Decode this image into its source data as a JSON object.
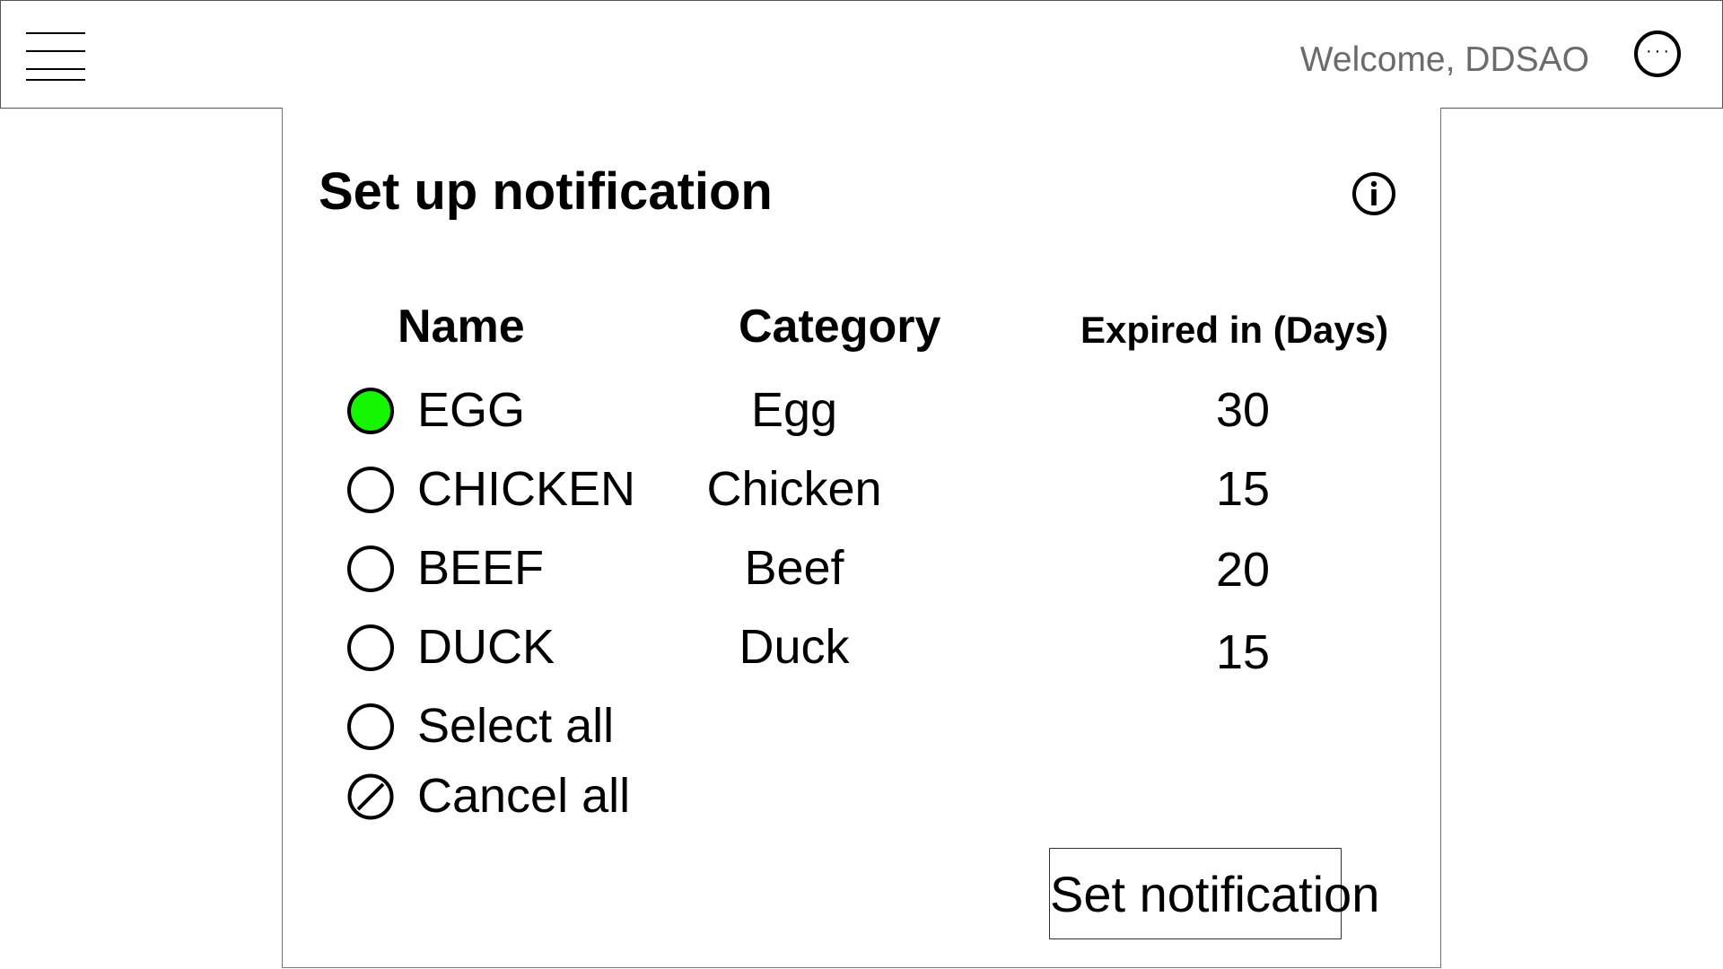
{
  "header": {
    "welcome_text": "Welcome, DDSAO",
    "menu_icon": "hamburger-menu-icon",
    "more_icon": "more-options-icon",
    "more_glyph": "···"
  },
  "panel": {
    "title": "Set up notification",
    "info_icon": "info-icon"
  },
  "table": {
    "columns": [
      "Name",
      "Category",
      "Expired in (Days)"
    ],
    "rows": [
      {
        "name": "EGG",
        "category": "Egg",
        "expires": "30",
        "selected": true
      },
      {
        "name": "CHICKEN",
        "category": "Chicken",
        "expires": "15",
        "selected": false
      },
      {
        "name": "BEEF",
        "category": "Beef",
        "expires": "20",
        "selected": false
      },
      {
        "name": "DUCK",
        "category": "Duck",
        "expires": "15",
        "selected": false
      }
    ],
    "select_all_label": "Select all",
    "cancel_all_label": "Cancel all"
  },
  "actions": {
    "set_notification_label": "Set notification"
  },
  "colors": {
    "selected_fill": "#16f500",
    "welcome_text": "#6b6b6b"
  }
}
